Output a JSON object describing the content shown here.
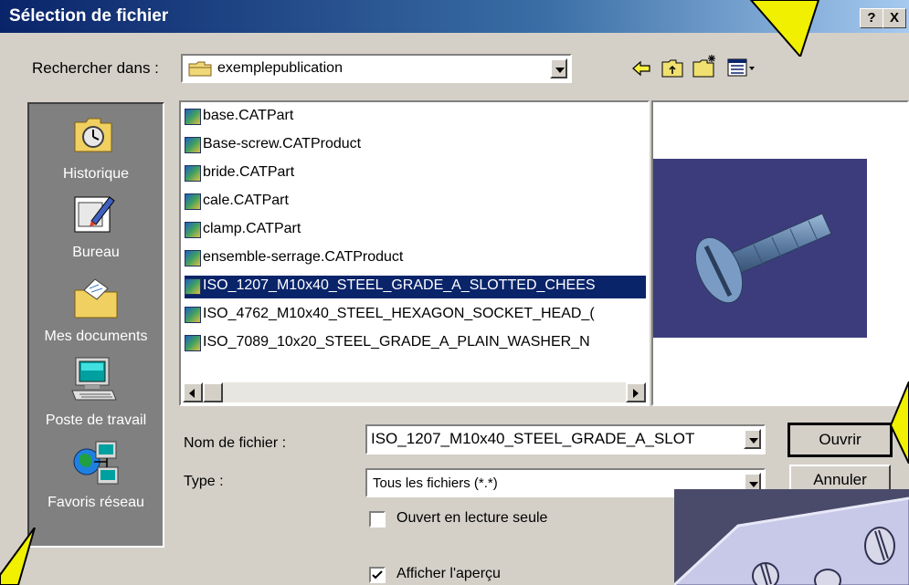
{
  "dialog": {
    "title": "Sélection de fichier",
    "help_btn": "?",
    "close_btn": "X"
  },
  "lookin": {
    "label": "Rechercher dans :",
    "value": "exemplepublication",
    "icon": "folder-icon"
  },
  "toolbar": {
    "icons": [
      "back-arrow-icon",
      "up-folder-icon",
      "new-folder-icon",
      "view-menu-icon"
    ]
  },
  "places": [
    {
      "label": "Historique",
      "icon": "history-clock-icon"
    },
    {
      "label": "Bureau",
      "icon": "desktop-icon"
    },
    {
      "label": "Mes documents",
      "icon": "my-documents-icon"
    },
    {
      "label": "Poste de travail",
      "icon": "computer-icon"
    },
    {
      "label": "Favoris réseau",
      "icon": "network-icon"
    }
  ],
  "files": [
    {
      "name": "base.CATPart"
    },
    {
      "name": "Base-screw.CATProduct"
    },
    {
      "name": "bride.CATPart"
    },
    {
      "name": "cale.CATPart"
    },
    {
      "name": "clamp.CATPart"
    },
    {
      "name": "ensemble-serrage.CATProduct"
    },
    {
      "name": "ISO_1207_M10x40_STEEL_GRADE_A_SLOTTED_CHEES",
      "selected": true
    },
    {
      "name": "ISO_4762_M10x40_STEEL_HEXAGON_SOCKET_HEAD_("
    },
    {
      "name": "ISO_7089_10x20_STEEL_GRADE_A_PLAIN_WASHER_N"
    }
  ],
  "filename": {
    "label": "Nom de fichier :",
    "value": "ISO_1207_M10x40_STEEL_GRADE_A_SLOT"
  },
  "filetype": {
    "label": "Type :",
    "value": "Tous les fichiers (*.*)"
  },
  "buttons": {
    "open": "Ouvrir",
    "cancel": "Annuler"
  },
  "options": {
    "readonly_label": "Ouvert en lecture seule",
    "readonly_checked": false,
    "preview_label": "Afficher l'aperçu",
    "preview_checked": true
  },
  "colors": {
    "title_start": "#0a246a",
    "selection": "#0a246a",
    "dialog_bg": "#d4d0c8",
    "preview_bg": "#3c3c7c",
    "callout": "#f0f000"
  }
}
